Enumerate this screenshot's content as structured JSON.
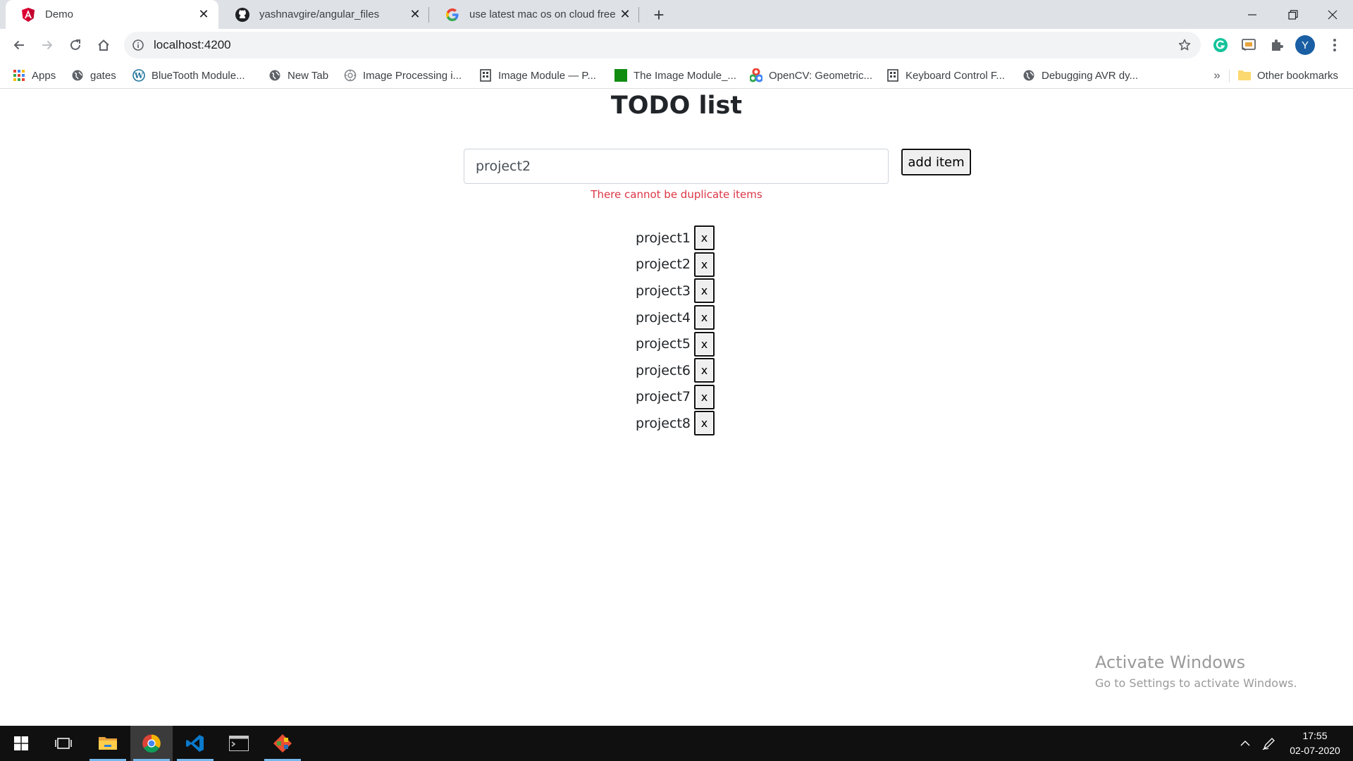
{
  "browser": {
    "tabs": [
      {
        "title": "Demo",
        "icon": "angular-icon",
        "active": true
      },
      {
        "title": "yashnavgire/angular_files",
        "icon": "github-icon",
        "active": false
      },
      {
        "title": "use latest mac os on cloud free",
        "icon": "google-icon",
        "active": false
      }
    ],
    "url": "localhost:4200",
    "profile_initial": "Y",
    "bookmarks": [
      {
        "label": "Apps",
        "icon": "apps-grid-icon"
      },
      {
        "label": "gates",
        "icon": "globe-icon"
      },
      {
        "label": "BlueTooth Module...",
        "icon": "wordpress-icon"
      },
      {
        "label": "New Tab",
        "icon": "globe-icon"
      },
      {
        "label": "Image Processing i...",
        "icon": "gear-site-icon"
      },
      {
        "label": "Image Module — P...",
        "icon": "building-icon"
      },
      {
        "label": "The Image Module_...",
        "icon": "green-square-icon"
      },
      {
        "label": "OpenCV: Geometric...",
        "icon": "opencv-icon"
      },
      {
        "label": "Keyboard Control F...",
        "icon": "building-icon"
      },
      {
        "label": "Debugging AVR dy...",
        "icon": "globe-icon"
      }
    ],
    "other_bookmarks": "Other bookmarks",
    "more_bookmarks": "»"
  },
  "app": {
    "title": "TODO list",
    "input_value": "project2",
    "add_button_label": "add item",
    "error_message": "There cannot be duplicate items",
    "items": [
      "project1",
      "project2",
      "project3",
      "project4",
      "project5",
      "project6",
      "project7",
      "project8"
    ],
    "delete_label": "x"
  },
  "watermark": {
    "title": "Activate Windows",
    "subtitle": "Go to Settings to activate Windows."
  },
  "taskbar": {
    "apps": [
      "windows-start-icon",
      "task-view-icon",
      "file-explorer-icon",
      "chrome-icon",
      "vscode-icon",
      "terminal-icon",
      "git-gui-icon"
    ],
    "time": "17:55",
    "date": "02-07-2020"
  },
  "colors": {
    "error": "#dc3545",
    "tab_strip": "#dee1e6",
    "taskbar": "#101010",
    "taskbar_accent": "#76b9ed"
  }
}
